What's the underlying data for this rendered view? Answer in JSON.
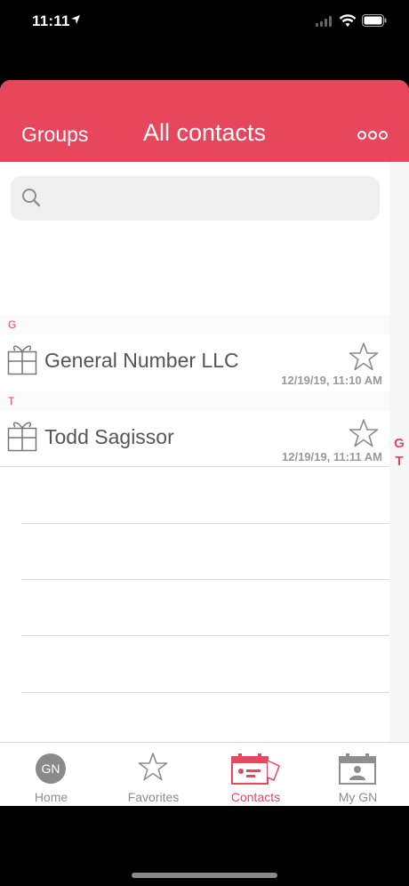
{
  "status_bar": {
    "time": "11:11"
  },
  "nav": {
    "left_label": "Groups",
    "title": "All contacts"
  },
  "search": {
    "placeholder": ""
  },
  "sections": [
    {
      "letter": "G",
      "contacts": [
        {
          "name": "General Number LLC",
          "timestamp": "12/19/19, 11:10 AM",
          "favorite": false
        }
      ]
    },
    {
      "letter": "T",
      "contacts": [
        {
          "name": "Todd Sagissor",
          "timestamp": "12/19/19, 11:11 AM",
          "favorite": false
        }
      ]
    }
  ],
  "index_letters": [
    "G",
    "T"
  ],
  "tabs": [
    {
      "label": "Home",
      "badge": "GN",
      "icon": "gn-badge-icon",
      "active": false
    },
    {
      "label": "Favorites",
      "icon": "star-icon",
      "active": false
    },
    {
      "label": "Contacts",
      "icon": "contacts-card-icon",
      "active": true
    },
    {
      "label": "My GN",
      "icon": "profile-card-icon",
      "active": false
    }
  ],
  "colors": {
    "accent": "#e8465c",
    "inactive": "#8e8e8e"
  }
}
